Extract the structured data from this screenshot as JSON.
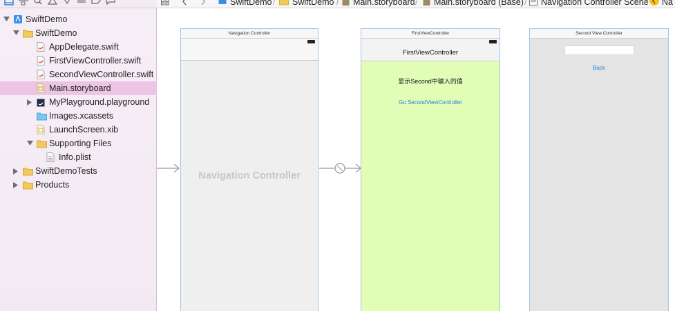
{
  "navigator": {
    "toolbar_icons": [
      "project-navigator-icon",
      "symbol-navigator-icon",
      "find-navigator-icon",
      "issue-navigator-icon",
      "test-navigator-icon",
      "debug-navigator-icon",
      "breakpoint-navigator-icon",
      "report-navigator-icon"
    ],
    "tree": [
      {
        "label": "SwiftDemo",
        "icon": "project-icon",
        "disclosure": "open",
        "level": 0
      },
      {
        "label": "SwiftDemo",
        "icon": "folder-icon",
        "disclosure": "open",
        "level": 1
      },
      {
        "label": "AppDelegate.swift",
        "icon": "swift-file-icon",
        "disclosure": "none",
        "level": 2
      },
      {
        "label": "FirstViewController.swift",
        "icon": "swift-file-icon",
        "disclosure": "none",
        "level": 2
      },
      {
        "label": "SecondViewController.swift",
        "icon": "swift-file-icon",
        "disclosure": "none",
        "level": 2
      },
      {
        "label": "Main.storyboard",
        "icon": "storyboard-icon",
        "disclosure": "none",
        "level": 2,
        "selected": true
      },
      {
        "label": "MyPlayground.playground",
        "icon": "playground-icon",
        "disclosure": "closed",
        "level": 2
      },
      {
        "label": "Images.xcassets",
        "icon": "asset-catalog-icon",
        "disclosure": "none",
        "level": 2
      },
      {
        "label": "LaunchScreen.xib",
        "icon": "xib-icon",
        "disclosure": "none",
        "level": 2
      },
      {
        "label": "Supporting Files",
        "icon": "folder-icon",
        "disclosure": "open",
        "level": 2
      },
      {
        "label": "Info.plist",
        "icon": "plist-icon",
        "disclosure": "none",
        "level": 3
      },
      {
        "label": "SwiftDemoTests",
        "icon": "folder-icon",
        "disclosure": "closed",
        "level": 1
      },
      {
        "label": "Products",
        "icon": "folder-icon",
        "disclosure": "closed",
        "level": 1
      }
    ]
  },
  "jumpbar": {
    "items": [
      "SwiftDemo",
      "SwiftDemo",
      "Main.storyboard",
      "Main.storyboard (Base)",
      "Navigation Controller Scene",
      "Na"
    ]
  },
  "canvas": {
    "nav_scene": {
      "title": "Navigation Controller",
      "watermark": "Navigation Controller"
    },
    "first_scene": {
      "title": "FirstViewController",
      "nav_title": "FirstViewController",
      "label": "显示Second中输入的值",
      "button": "Go SecondViewController",
      "bg_color": "#e2fdb6"
    },
    "second_scene": {
      "title": "Second View Controller",
      "textfield_value": "",
      "button": "Back",
      "bg_color": "#e4e4e4"
    },
    "colors": {
      "accent": "#1f7fe6",
      "selection": "#ecc4e4",
      "scene_border": "#9fc3e6"
    }
  }
}
